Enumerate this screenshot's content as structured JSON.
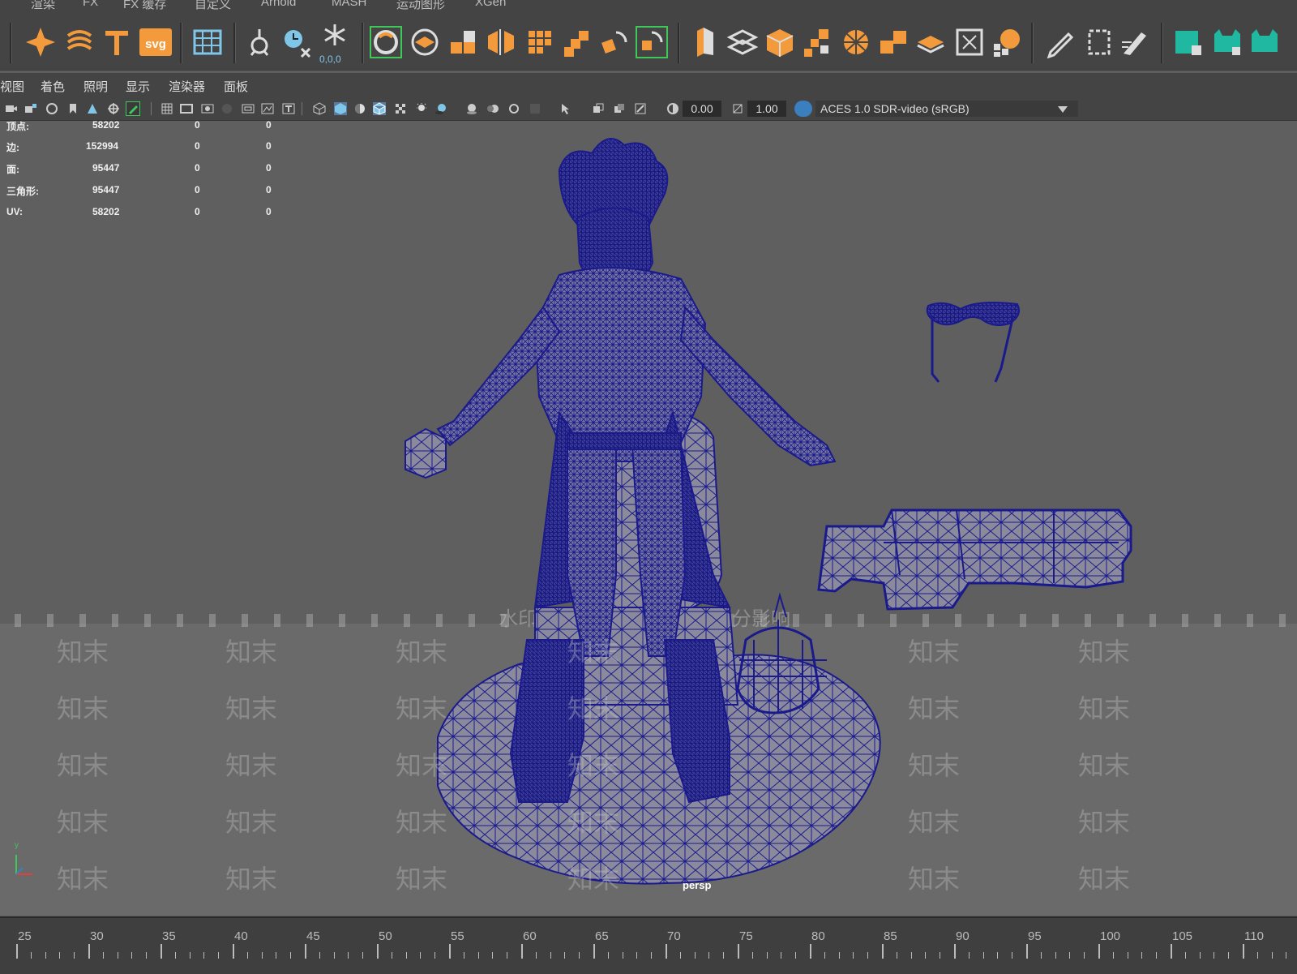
{
  "menubar": {
    "items": [
      "渲染",
      "FX",
      "FX 缓存",
      "自定义",
      "Arnold",
      "MASH",
      "运动图形",
      "XGen"
    ]
  },
  "shelf": {
    "icons": [
      "sparkle-icon",
      "spiral-text-icon",
      "text-T-icon",
      "svg-icon",
      "grid-table-icon",
      "joint-icon",
      "clock-x-icon",
      "snowflake-icon",
      "wrap-circle-icon",
      "layered-disk-icon",
      "blocks-icon",
      "split-cube-icon",
      "grid-cubes-icon",
      "stair-cubes-icon",
      "rotate-cubes-icon",
      "rotate-cubes-2-icon",
      "tall-box-icon",
      "flat-layers-icon",
      "cube-icon",
      "scatter-cubes-icon",
      "sphere-grid-icon",
      "cube-pair-icon",
      "flat-diamond-icon",
      "frame-icon",
      "globe-cubes-icon",
      "pencil-icon",
      "frame-dashed-icon",
      "brush-icon",
      "green-square-icon",
      "green-cat-icon",
      "green-cat-2-icon"
    ],
    "svg_label": "svg",
    "coord_label": "0,0,0"
  },
  "panel_menu": {
    "items": [
      "视图",
      "着色",
      "照明",
      "显示",
      "渲染器",
      "面板"
    ]
  },
  "panel_toolbar": {
    "value1": "0.00",
    "value2": "1.00",
    "colorspace": "ACES 1.0 SDR-video (sRGB)"
  },
  "hud": {
    "rows": [
      {
        "label": "顶点:",
        "v1": "58202",
        "v2": "0",
        "v3": "0"
      },
      {
        "label": "边:",
        "v1": "152994",
        "v2": "0",
        "v3": "0"
      },
      {
        "label": "面:",
        "v1": "95447",
        "v2": "0",
        "v3": "0"
      },
      {
        "label": "三角形:",
        "v1": "95447",
        "v2": "0",
        "v3": "0"
      },
      {
        "label": "UV:",
        "v1": "58202",
        "v2": "0",
        "v3": "0"
      }
    ]
  },
  "viewport": {
    "camera_label": "persp",
    "axis_label": "y",
    "watermark_title": "水印保护区，画面会受到部分影响",
    "watermark_text": "知末",
    "wire_color": "#1a1a8c"
  },
  "time_slider": {
    "labels": [
      "25",
      "30",
      "35",
      "40",
      "45",
      "50",
      "55",
      "60",
      "65",
      "70",
      "75",
      "80",
      "85",
      "90",
      "95",
      "100",
      "105",
      "110"
    ]
  }
}
